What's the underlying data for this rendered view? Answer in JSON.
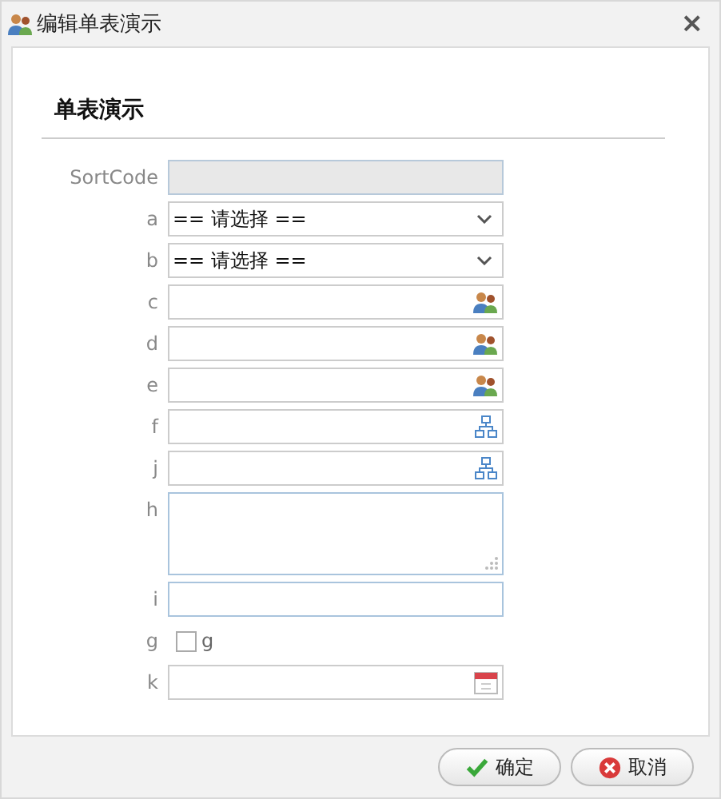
{
  "window": {
    "title": "编辑单表演示",
    "close": "×"
  },
  "section_title": "单表演示",
  "fields": [
    {
      "label": "SortCode",
      "kind": "readonly"
    },
    {
      "label": "a",
      "kind": "select",
      "value": "== 请选择 =="
    },
    {
      "label": "b",
      "kind": "select",
      "value": "== 请选择 =="
    },
    {
      "label": "c",
      "kind": "user"
    },
    {
      "label": "d",
      "kind": "user"
    },
    {
      "label": "e",
      "kind": "user"
    },
    {
      "label": "f",
      "kind": "org"
    },
    {
      "label": "j",
      "kind": "org"
    },
    {
      "label": "h",
      "kind": "textarea"
    },
    {
      "label": "i",
      "kind": "text"
    },
    {
      "label": "g",
      "kind": "checkbox",
      "checked": false,
      "option": "g"
    },
    {
      "label": "k",
      "kind": "date"
    }
  ],
  "buttons": [
    {
      "label": "确定",
      "kind": "ok"
    },
    {
      "label": "取消",
      "kind": "cancel"
    }
  ]
}
